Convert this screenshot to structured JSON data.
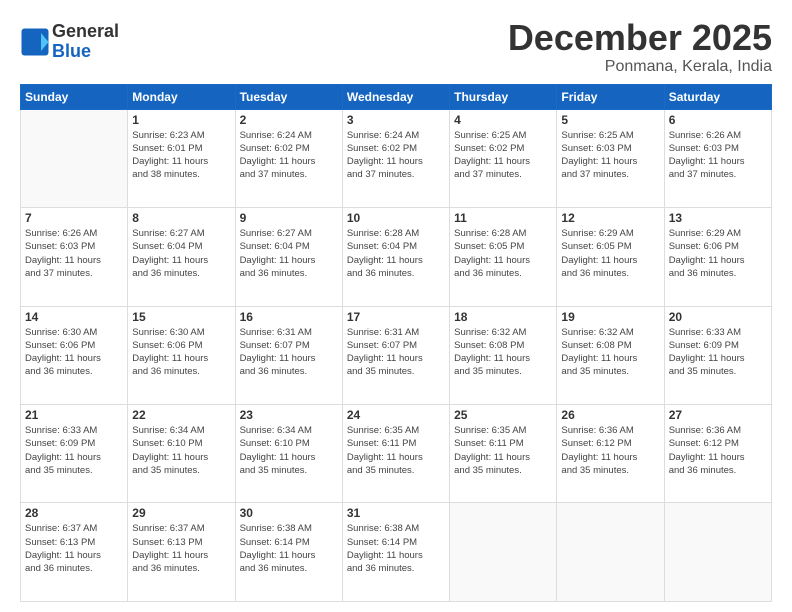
{
  "logo": {
    "line1": "General",
    "line2": "Blue"
  },
  "title": "December 2025",
  "location": "Ponmana, Kerala, India",
  "days_header": [
    "Sunday",
    "Monday",
    "Tuesday",
    "Wednesday",
    "Thursday",
    "Friday",
    "Saturday"
  ],
  "weeks": [
    [
      {
        "day": "",
        "info": ""
      },
      {
        "day": "1",
        "info": "Sunrise: 6:23 AM\nSunset: 6:01 PM\nDaylight: 11 hours\nand 38 minutes."
      },
      {
        "day": "2",
        "info": "Sunrise: 6:24 AM\nSunset: 6:02 PM\nDaylight: 11 hours\nand 37 minutes."
      },
      {
        "day": "3",
        "info": "Sunrise: 6:24 AM\nSunset: 6:02 PM\nDaylight: 11 hours\nand 37 minutes."
      },
      {
        "day": "4",
        "info": "Sunrise: 6:25 AM\nSunset: 6:02 PM\nDaylight: 11 hours\nand 37 minutes."
      },
      {
        "day": "5",
        "info": "Sunrise: 6:25 AM\nSunset: 6:03 PM\nDaylight: 11 hours\nand 37 minutes."
      },
      {
        "day": "6",
        "info": "Sunrise: 6:26 AM\nSunset: 6:03 PM\nDaylight: 11 hours\nand 37 minutes."
      }
    ],
    [
      {
        "day": "7",
        "info": "Sunrise: 6:26 AM\nSunset: 6:03 PM\nDaylight: 11 hours\nand 37 minutes."
      },
      {
        "day": "8",
        "info": "Sunrise: 6:27 AM\nSunset: 6:04 PM\nDaylight: 11 hours\nand 36 minutes."
      },
      {
        "day": "9",
        "info": "Sunrise: 6:27 AM\nSunset: 6:04 PM\nDaylight: 11 hours\nand 36 minutes."
      },
      {
        "day": "10",
        "info": "Sunrise: 6:28 AM\nSunset: 6:04 PM\nDaylight: 11 hours\nand 36 minutes."
      },
      {
        "day": "11",
        "info": "Sunrise: 6:28 AM\nSunset: 6:05 PM\nDaylight: 11 hours\nand 36 minutes."
      },
      {
        "day": "12",
        "info": "Sunrise: 6:29 AM\nSunset: 6:05 PM\nDaylight: 11 hours\nand 36 minutes."
      },
      {
        "day": "13",
        "info": "Sunrise: 6:29 AM\nSunset: 6:06 PM\nDaylight: 11 hours\nand 36 minutes."
      }
    ],
    [
      {
        "day": "14",
        "info": "Sunrise: 6:30 AM\nSunset: 6:06 PM\nDaylight: 11 hours\nand 36 minutes."
      },
      {
        "day": "15",
        "info": "Sunrise: 6:30 AM\nSunset: 6:06 PM\nDaylight: 11 hours\nand 36 minutes."
      },
      {
        "day": "16",
        "info": "Sunrise: 6:31 AM\nSunset: 6:07 PM\nDaylight: 11 hours\nand 36 minutes."
      },
      {
        "day": "17",
        "info": "Sunrise: 6:31 AM\nSunset: 6:07 PM\nDaylight: 11 hours\nand 35 minutes."
      },
      {
        "day": "18",
        "info": "Sunrise: 6:32 AM\nSunset: 6:08 PM\nDaylight: 11 hours\nand 35 minutes."
      },
      {
        "day": "19",
        "info": "Sunrise: 6:32 AM\nSunset: 6:08 PM\nDaylight: 11 hours\nand 35 minutes."
      },
      {
        "day": "20",
        "info": "Sunrise: 6:33 AM\nSunset: 6:09 PM\nDaylight: 11 hours\nand 35 minutes."
      }
    ],
    [
      {
        "day": "21",
        "info": "Sunrise: 6:33 AM\nSunset: 6:09 PM\nDaylight: 11 hours\nand 35 minutes."
      },
      {
        "day": "22",
        "info": "Sunrise: 6:34 AM\nSunset: 6:10 PM\nDaylight: 11 hours\nand 35 minutes."
      },
      {
        "day": "23",
        "info": "Sunrise: 6:34 AM\nSunset: 6:10 PM\nDaylight: 11 hours\nand 35 minutes."
      },
      {
        "day": "24",
        "info": "Sunrise: 6:35 AM\nSunset: 6:11 PM\nDaylight: 11 hours\nand 35 minutes."
      },
      {
        "day": "25",
        "info": "Sunrise: 6:35 AM\nSunset: 6:11 PM\nDaylight: 11 hours\nand 35 minutes."
      },
      {
        "day": "26",
        "info": "Sunrise: 6:36 AM\nSunset: 6:12 PM\nDaylight: 11 hours\nand 35 minutes."
      },
      {
        "day": "27",
        "info": "Sunrise: 6:36 AM\nSunset: 6:12 PM\nDaylight: 11 hours\nand 36 minutes."
      }
    ],
    [
      {
        "day": "28",
        "info": "Sunrise: 6:37 AM\nSunset: 6:13 PM\nDaylight: 11 hours\nand 36 minutes."
      },
      {
        "day": "29",
        "info": "Sunrise: 6:37 AM\nSunset: 6:13 PM\nDaylight: 11 hours\nand 36 minutes."
      },
      {
        "day": "30",
        "info": "Sunrise: 6:38 AM\nSunset: 6:14 PM\nDaylight: 11 hours\nand 36 minutes."
      },
      {
        "day": "31",
        "info": "Sunrise: 6:38 AM\nSunset: 6:14 PM\nDaylight: 11 hours\nand 36 minutes."
      },
      {
        "day": "",
        "info": ""
      },
      {
        "day": "",
        "info": ""
      },
      {
        "day": "",
        "info": ""
      }
    ]
  ]
}
